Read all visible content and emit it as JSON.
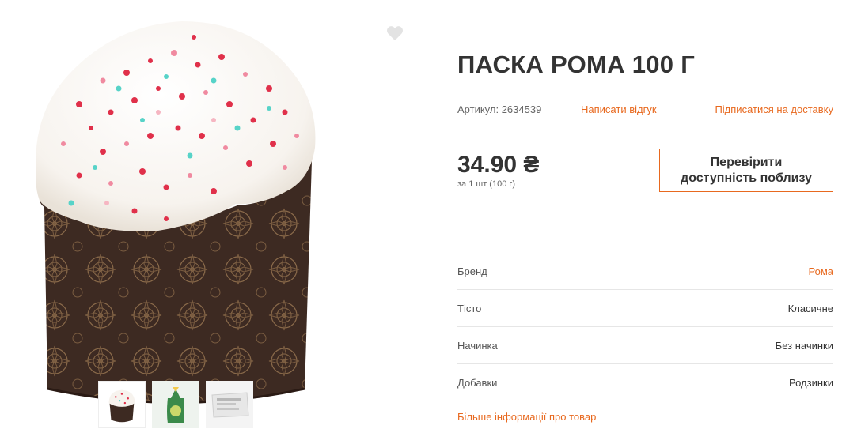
{
  "product": {
    "title": "ПАСКА РОМА 100 Г",
    "sku_label": "Артикул:",
    "sku_value": "2634539",
    "review_link": "Написати відгук",
    "subscribe_link": "Підписатися на доставку",
    "price": "34.90 ₴",
    "price_unit": "за 1 шт (100 г)",
    "check_button": "Перевірити доступність поблизу",
    "favorite_icon": "heart-icon",
    "properties": [
      {
        "name": "Бренд",
        "value": "Рома"
      },
      {
        "name": "Тісто",
        "value": "Класичне"
      },
      {
        "name": "Начинка",
        "value": "Без начинки"
      },
      {
        "name": "Добавки",
        "value": "Родзинки"
      }
    ],
    "more_info_link": "Більше інформації про товар"
  },
  "colors": {
    "accent": "#e8691f",
    "text": "#333333",
    "muted": "#666666",
    "divider": "#e6e6e6"
  }
}
